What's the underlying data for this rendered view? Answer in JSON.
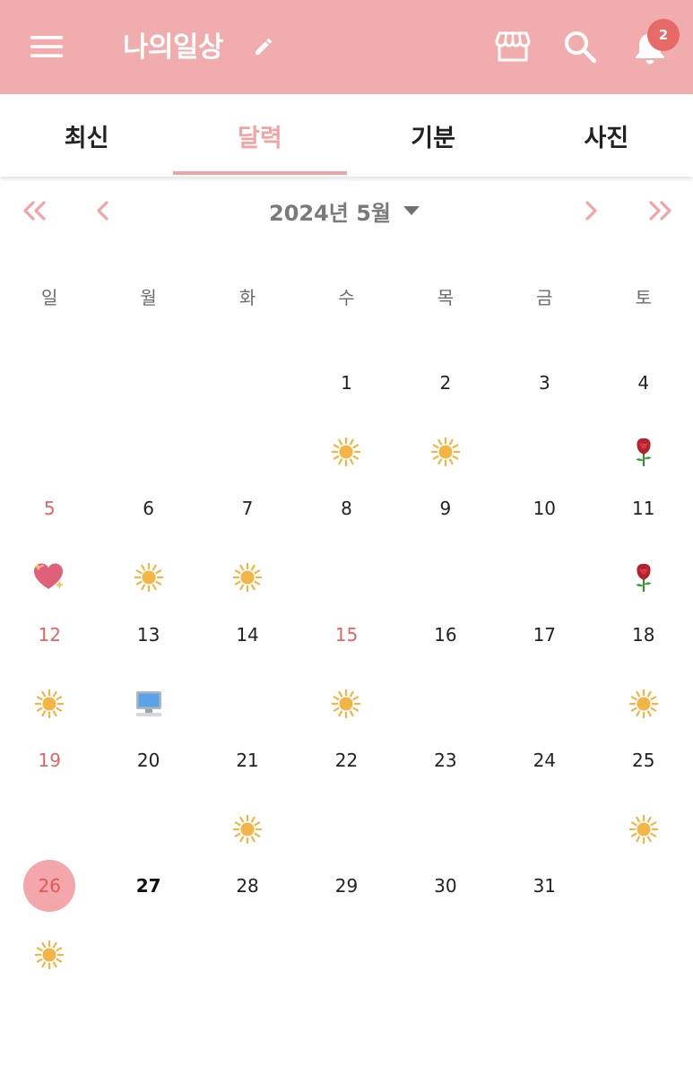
{
  "appbar": {
    "title": "나의일상",
    "notification_count": "2",
    "icons": [
      "menu-icon",
      "edit-icon",
      "store-icon",
      "search-icon",
      "bell-icon"
    ]
  },
  "tabs": [
    {
      "label": "최신",
      "active": false
    },
    {
      "label": "달력",
      "active": true
    },
    {
      "label": "기분",
      "active": false
    },
    {
      "label": "사진",
      "active": false
    }
  ],
  "calendar": {
    "month_label": "2024년 5월",
    "weekdays": [
      "일",
      "월",
      "화",
      "수",
      "목",
      "금",
      "토"
    ],
    "leading_blank_days": 3,
    "days": [
      {
        "day": "1",
        "mood": "sun"
      },
      {
        "day": "2",
        "mood": "sun"
      },
      {
        "day": "3",
        "mood": null
      },
      {
        "day": "4",
        "mood": "rose"
      },
      {
        "day": "5",
        "mood": "heart",
        "red": true
      },
      {
        "day": "6",
        "mood": "sun"
      },
      {
        "day": "7",
        "mood": "sun"
      },
      {
        "day": "8",
        "mood": null
      },
      {
        "day": "9",
        "mood": null
      },
      {
        "day": "10",
        "mood": null
      },
      {
        "day": "11",
        "mood": "rose"
      },
      {
        "day": "12",
        "mood": "sun",
        "red": true
      },
      {
        "day": "13",
        "mood": "computer"
      },
      {
        "day": "14",
        "mood": null
      },
      {
        "day": "15",
        "mood": "sun",
        "red": true
      },
      {
        "day": "16",
        "mood": null
      },
      {
        "day": "17",
        "mood": null
      },
      {
        "day": "18",
        "mood": "sun"
      },
      {
        "day": "19",
        "mood": null,
        "red": true
      },
      {
        "day": "20",
        "mood": null
      },
      {
        "day": "21",
        "mood": "sun"
      },
      {
        "day": "22",
        "mood": null
      },
      {
        "day": "23",
        "mood": null
      },
      {
        "day": "24",
        "mood": null
      },
      {
        "day": "25",
        "mood": "sun"
      },
      {
        "day": "26",
        "mood": "sun",
        "red": true,
        "selected": true
      },
      {
        "day": "27",
        "mood": null,
        "today": true
      },
      {
        "day": "28",
        "mood": null
      },
      {
        "day": "29",
        "mood": null
      },
      {
        "day": "30",
        "mood": null
      },
      {
        "day": "31",
        "mood": null
      }
    ]
  },
  "colors": {
    "appbar_bg": "#f1adae",
    "accent": "#f1a4a4",
    "holiday_red": "#e06666",
    "badge": "#e86a66",
    "selected_circle": "#f3a7ab",
    "sun": "#f2b548"
  }
}
